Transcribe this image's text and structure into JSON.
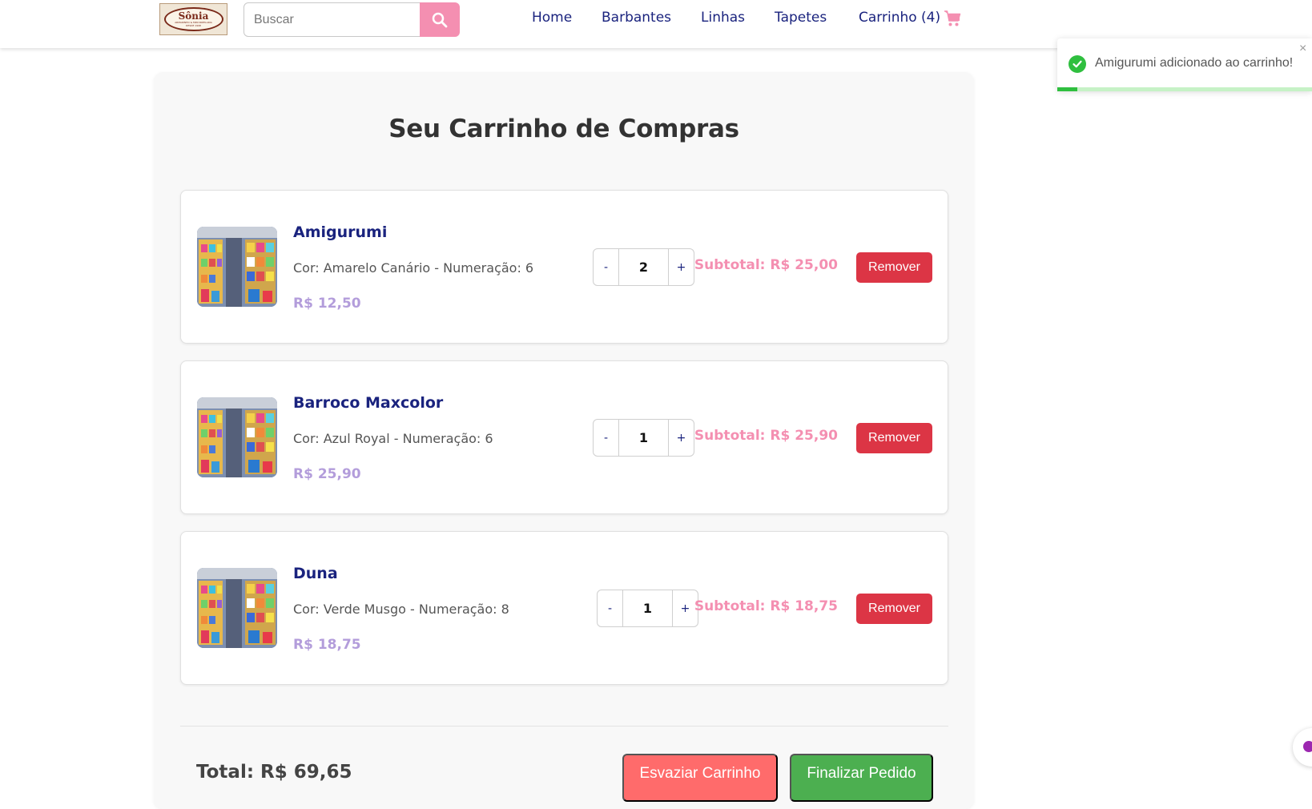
{
  "header": {
    "logo": {
      "line1": "Sônia",
      "line2": "ARMARINHO & MINI PAPELARIA",
      "line3": "DESDE 1998"
    },
    "search": {
      "placeholder": "Buscar"
    },
    "nav": [
      {
        "label": "Home"
      },
      {
        "label": "Barbantes"
      },
      {
        "label": "Linhas"
      },
      {
        "label": "Tapetes"
      },
      {
        "label": "Carrinho (4)"
      }
    ],
    "icons": {
      "search": "search-icon",
      "cart": "cart-icon"
    },
    "accent_color": "#f48fb1",
    "nav_color": "#1a237e"
  },
  "toast": {
    "message": "Amigurumi adicionado ao carrinho!",
    "close": "×",
    "progress": 0.08,
    "icon": "check-circle-icon"
  },
  "cart": {
    "title": "Seu Carrinho de Compras",
    "items": [
      {
        "name": "Amigurumi",
        "details": "Cor: Amarelo Canário - Numeração: 6",
        "price": "R$ 12,50",
        "quantity": "2",
        "subtotal": "Subtotal: R$ 25,00",
        "remove_label": "Remover"
      },
      {
        "name": "Barroco Maxcolor",
        "details": "Cor: Azul Royal - Numeração: 6",
        "price": "R$ 25,90",
        "quantity": "1",
        "subtotal": "Subtotal: R$ 25,90",
        "remove_label": "Remover"
      },
      {
        "name": "Duna",
        "details": "Cor: Verde Musgo - Numeração: 8",
        "price": "R$ 18,75",
        "quantity": "1",
        "subtotal": "Subtotal: R$ 18,75",
        "remove_label": "Remover"
      }
    ],
    "decrement_label": "-",
    "increment_label": "+",
    "total": "Total: R$ 69,65",
    "clear_label": "Esvaziar Carrinho",
    "finish_label": "Finalizar Pedido",
    "colors": {
      "remove": "#dc3545",
      "clear": "#ff6b6b",
      "finish": "#4caf50",
      "price": "#b39ddb",
      "subtotal": "#f48fb1"
    }
  }
}
